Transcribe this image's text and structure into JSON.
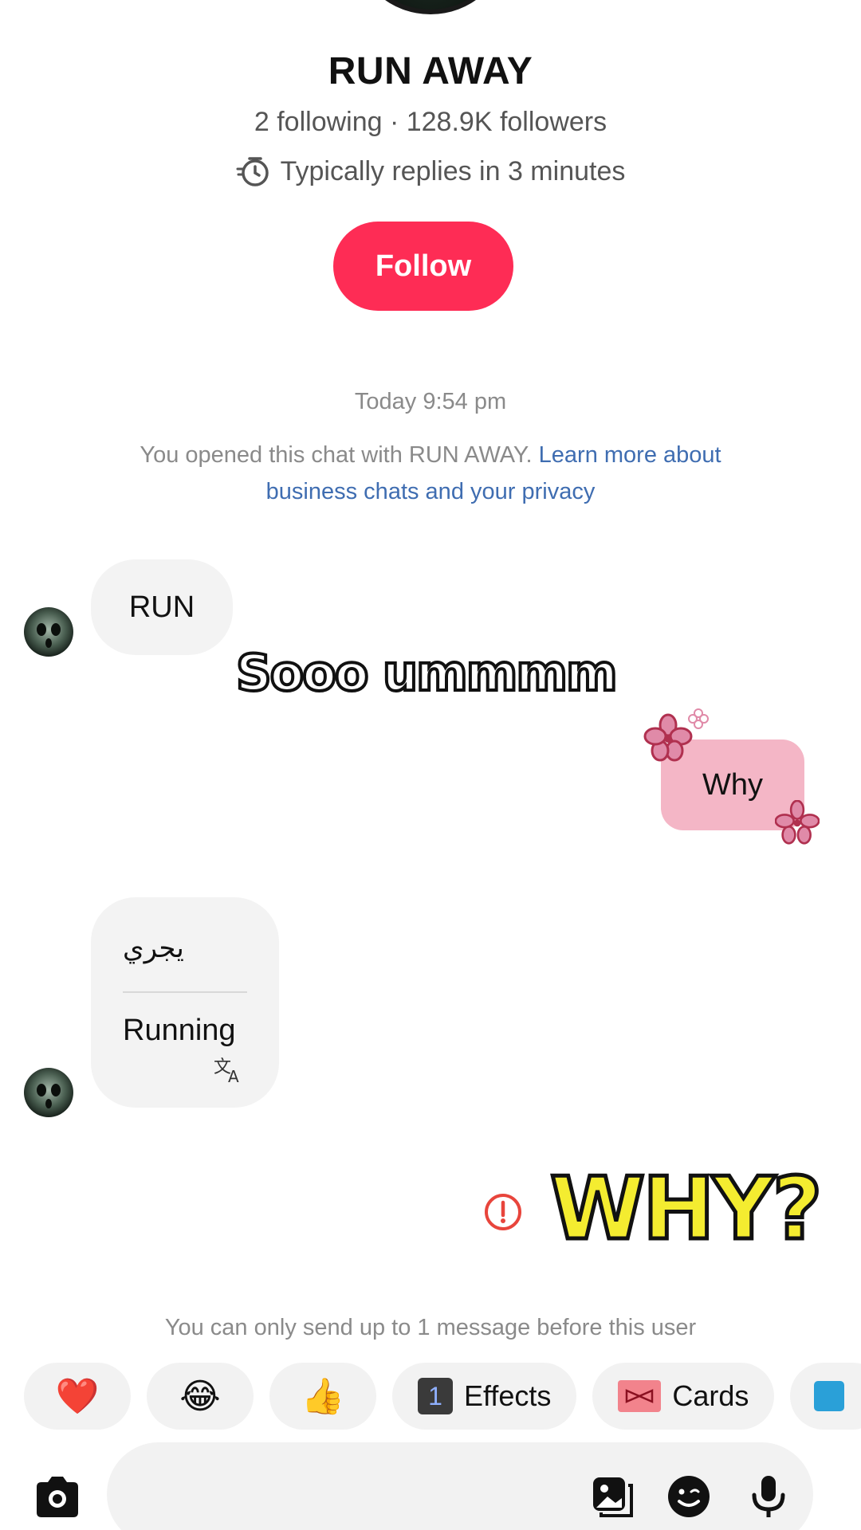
{
  "profile": {
    "name": "RUN AWAY",
    "stats": "2 following · 128.9K followers",
    "reply_time": "Typically replies in 3 minutes",
    "follow_label": "Follow"
  },
  "chat": {
    "timestamp": "Today 9:54 pm",
    "notice_prefix": "You opened this chat with RUN AWAY. ",
    "notice_link": "Learn more about business chats and your privacy",
    "messages": [
      {
        "from": "them",
        "text": "RUN"
      },
      {
        "from": "me",
        "text": "Why"
      },
      {
        "from": "them",
        "original": "يجري",
        "translation": "Running"
      }
    ],
    "limit_notice": "You can only send up to 1 message before this user"
  },
  "overlay": {
    "caption": "Sooo ummmm",
    "sticker": "WHY?"
  },
  "quick_actions": [
    {
      "type": "emoji",
      "label": "❤️",
      "icon": "heart-icon"
    },
    {
      "type": "emoji",
      "label": "😂",
      "icon": "laughing-emoji-icon"
    },
    {
      "type": "emoji",
      "label": "👍",
      "icon": "thumbs-up-icon"
    },
    {
      "type": "text",
      "label": "Effects",
      "badge": "1"
    },
    {
      "type": "text",
      "label": "Cards",
      "icon": "cards-icon"
    }
  ],
  "colors": {
    "follow": "#fe2c55",
    "link": "#3f6db1",
    "my_bubble": "#f4b6c6",
    "error": "#e8453c"
  }
}
